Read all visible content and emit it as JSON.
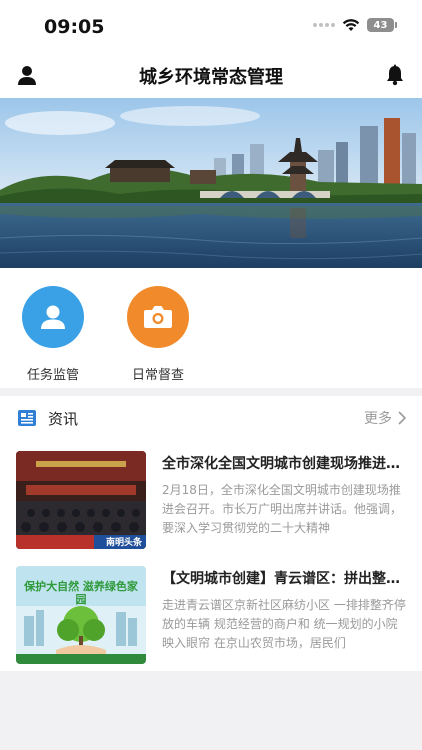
{
  "status_bar": {
    "time": "09:05",
    "battery": "43"
  },
  "header": {
    "title": "城乡环境常态管理",
    "user_icon": "user-icon",
    "bell_icon": "bell-icon"
  },
  "banner": {
    "image": "city-lake-pavilion-photo"
  },
  "quick_actions": [
    {
      "label": "任务监管",
      "icon": "person-icon",
      "color": "#3aa1e6"
    },
    {
      "label": "日常督查",
      "icon": "camera-icon",
      "color": "#f08a2b"
    }
  ],
  "news": {
    "title": "资讯",
    "more_label": "更多",
    "articles": [
      {
        "title": "全市深化全国文明城市创建现场推进会召开",
        "summary": "2月18日，全市深化全国文明城市创建现场推进会召开。市长万广明出席并讲话。他强调，要深入学习贯彻党的二十大精神",
        "thumb_caption": "南明头条"
      },
      {
        "title": "【文明城市创建】青云谱区：拼出整洁新面貌",
        "summary": "走进青云谱区京新社区麻纺小区 一排排整齐停放的车辆 规范经营的商户和 统一规划的小院映入眼帘 在京山农贸市场，居民们",
        "thumb_caption": "保护大自然 滋养绿色家园"
      }
    ]
  }
}
